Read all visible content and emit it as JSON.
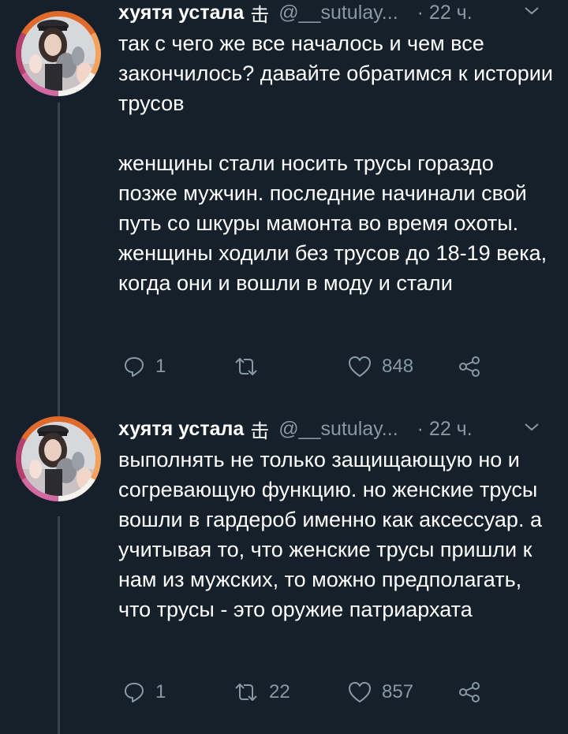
{
  "tweets": [
    {
      "author": "хуятя устала",
      "badge": "击",
      "handle": "@__sutulay...",
      "time": "· 22 ч.",
      "paragraphs": [
        "так с чего же все началось и чем все закончилось? давайте обратимся к истории трусов",
        "женщины стали носить трусы гораздо позже мужчин. последние начинали свой путь со шкуры мамонта во время охоты. женщины ходили без трусов до 18-19 века, когда они и вошли в моду и стали"
      ],
      "replies": "1",
      "retweets": "",
      "likes": "848"
    },
    {
      "author": "хуятя устала",
      "badge": "击",
      "handle": "@__sutulay...",
      "time": "· 22 ч.",
      "paragraphs": [
        "выполнять не только защищающую но и согревающую функцию. но женские трусы вошли в гардероб именно как аксессуар. а учитывая то, что женские трусы пришли к нам из мужских, то можно предполагать, что трусы - это оружие патриархата"
      ],
      "replies": "1",
      "retweets": "22",
      "likes": "857"
    }
  ],
  "colors": {
    "background": "#15202b",
    "secondary_text": "#8899a6",
    "thread_line": "#38444d"
  }
}
